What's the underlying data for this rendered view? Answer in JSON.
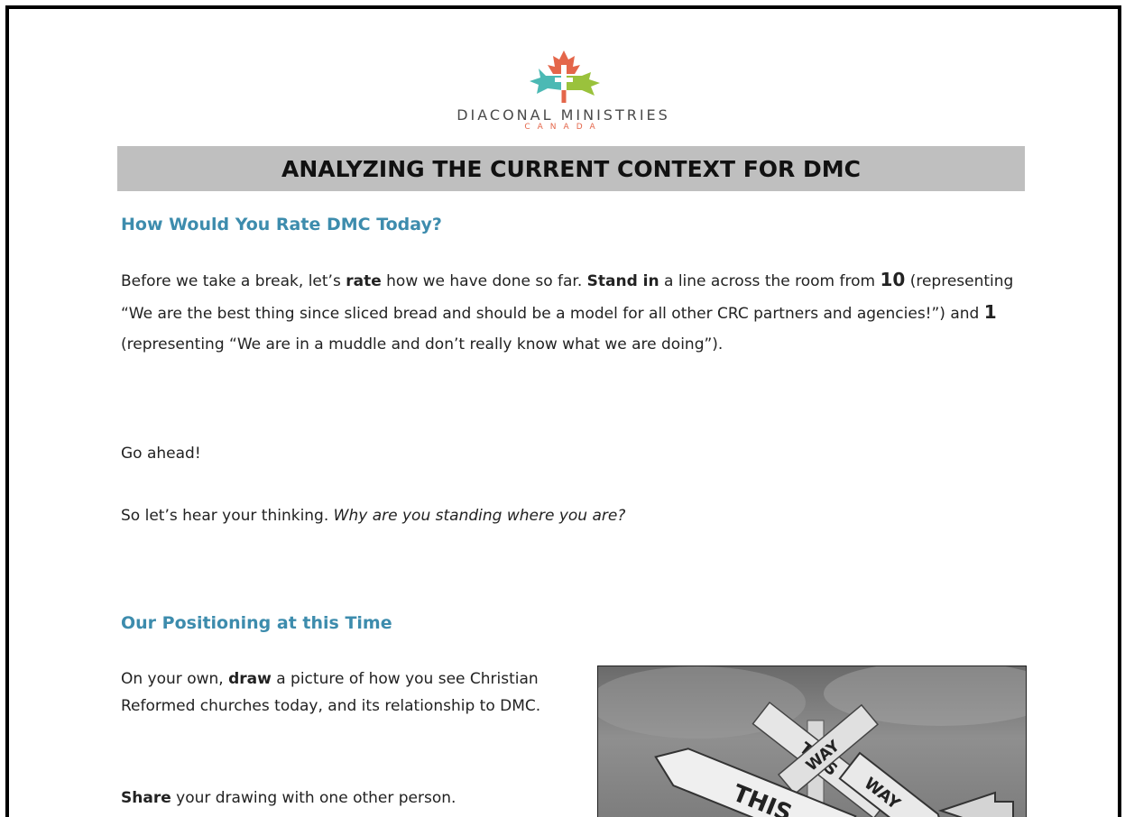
{
  "logo": {
    "name": "DIACONAL MINISTRIES",
    "sub": "CANADA",
    "colors": {
      "orange": "#e4664a",
      "teal": "#4bb9b4",
      "green": "#9ac23c"
    }
  },
  "title": "ANALYZING THE CURRENT CONTEXT FOR DMC",
  "section1": {
    "heading": "How Would You Rate DMC Today?",
    "para1": {
      "t1": "Before we take a break, let’s ",
      "b1": "rate",
      "t2": " how we have done so far. ",
      "b2": "Stand in",
      "t3": " a line across the room from ",
      "n1": "10",
      "t4": " (representing “We are the best thing since sliced bread and should be a model for all other CRC partners and agencies!”) and ",
      "n2": "1",
      "t5": " (representing “We are in a muddle and don’t really know what we are doing”)."
    },
    "para2": "Go ahead!",
    "para3": {
      "t1": "So let’s hear your thinking. ",
      "i1": "Why are you standing where you are?"
    }
  },
  "section2": {
    "heading": "Our Positioning at this Time",
    "para1": {
      "t1": "On your own, ",
      "b1": "draw",
      "t2": " a picture of how you see Christian Reformed churches today, and its relationship to DMC."
    },
    "para2": {
      "b1": "Share",
      "t1": " your drawing with one other person."
    },
    "image": {
      "signs": [
        "THIS",
        "WAY",
        "THIS",
        "WAY"
      ]
    }
  },
  "colors": {
    "heading": "#3d8cad",
    "title_bar": "#bfbfbf"
  }
}
